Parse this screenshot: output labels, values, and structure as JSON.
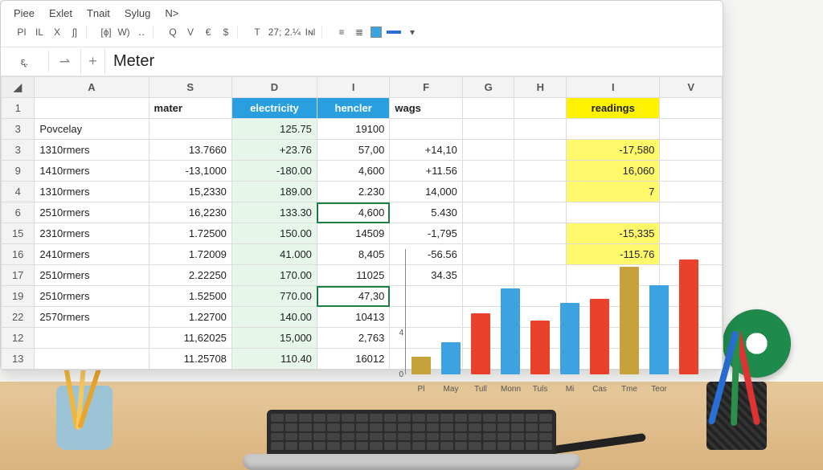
{
  "menu": {
    "items": [
      "Piee",
      "Exlet",
      "Tnait",
      "Sylug",
      "N>"
    ]
  },
  "toolbar": {
    "g1": [
      "PI",
      "IL",
      "X",
      "ʃ]"
    ],
    "g2": [
      "[ɸ]",
      "W)",
      "‥"
    ],
    "g3": [
      "Q",
      "V",
      "€",
      "$"
    ],
    "g4": [
      "T",
      "27;",
      "2.¼",
      "Iɴl"
    ],
    "g5_icons": [
      "align-left-icon",
      "align-center-icon",
      "fill-color-icon",
      "line-color-icon",
      "chevron-down-icon"
    ]
  },
  "formula_bar": {
    "namebox": "ᶓ.",
    "fx_icon": "⇀",
    "plus": "+",
    "value": "Meter"
  },
  "columns": [
    "A",
    "S",
    "D",
    "I",
    "F",
    "G",
    "H",
    "I",
    "V"
  ],
  "header_row": {
    "row_num": "1",
    "A": "",
    "S": "mater",
    "D": "electricity",
    "I": "hencler",
    "F": "wags",
    "G": "",
    "H": "",
    "I2": "readings",
    "V": ""
  },
  "rows": [
    {
      "n": "3",
      "A": "Povcelay",
      "S": "",
      "D": "125.75",
      "I": "19100",
      "F": "",
      "I2": ""
    },
    {
      "n": "3",
      "A": "1310rmers",
      "S": "13.7660",
      "D": "+23.76",
      "I": "57,00",
      "F": "+14,10",
      "I2": "-17,580"
    },
    {
      "n": "9",
      "A": "1410rmers",
      "S": "-13,1000",
      "D": "-180.00",
      "I": "4,600",
      "F": "+11.56",
      "I2": "16,060"
    },
    {
      "n": "4",
      "A": "1310rmers",
      "S": "15,2330",
      "D": "189.00",
      "I": "2.230",
      "F": "14,000",
      "I2": "7"
    },
    {
      "n": "6",
      "A": "2510rmers",
      "S": "16,2230",
      "D": "133.30",
      "I": "4,600",
      "F": "5.430",
      "I2": "",
      "sel": "I"
    },
    {
      "n": "15",
      "A": "2310rmers",
      "S": "1.72500",
      "D": "150.00",
      "I": "14509",
      "F": "-1,795",
      "I2": "-15,335"
    },
    {
      "n": "16",
      "A": "2410rmers",
      "S": "1.72009",
      "D": "41.000",
      "I": "8,405",
      "F": "-56.56",
      "I2": "-115.76"
    },
    {
      "n": "17",
      "A": "2510rmers",
      "S": "2.22250",
      "D": "170.00",
      "I": "11025",
      "F": "34.35",
      "I2": ""
    },
    {
      "n": "19",
      "A": "2510rmers",
      "S": "1.52500",
      "D": "770.00",
      "I": "47,30",
      "F": "",
      "I2": "",
      "sel": "I"
    },
    {
      "n": "22",
      "A": "2570rmers",
      "S": "1.22700",
      "D": "140.00",
      "I": "10413",
      "F": "",
      "I2": ""
    },
    {
      "n": "12",
      "A": "",
      "S": "11,62025",
      "D": "15,000",
      "I": "2,763",
      "F": "",
      "I2": ""
    },
    {
      "n": "13",
      "A": "",
      "S": "11.25708",
      "D": "110.40",
      "I": "16012",
      "F": "",
      "I2": ""
    }
  ],
  "chart_data": {
    "type": "bar",
    "categories": [
      "Pl",
      "May",
      "Tull",
      "Monn",
      "Tuls",
      "Mi",
      "Cas",
      "Tme",
      "Teor"
    ],
    "values": [
      10,
      18,
      34,
      48,
      30,
      40,
      42,
      60,
      50,
      64
    ],
    "colors": [
      "#c7a23a",
      "#3da2e0",
      "#e9412a",
      "#3da2e0",
      "#e9412a",
      "#3da2e0",
      "#e9412a",
      "#c7a23a",
      "#3da2e0",
      "#e9412a"
    ],
    "yticks": [
      "0",
      "4"
    ],
    "ylim": [
      0,
      70
    ]
  },
  "colors": {
    "accent_blue": "#2a9fe0",
    "highlight_yellow": "#fff200",
    "green_cell": "#e6f6ea",
    "sel_border": "#1e7f46"
  }
}
